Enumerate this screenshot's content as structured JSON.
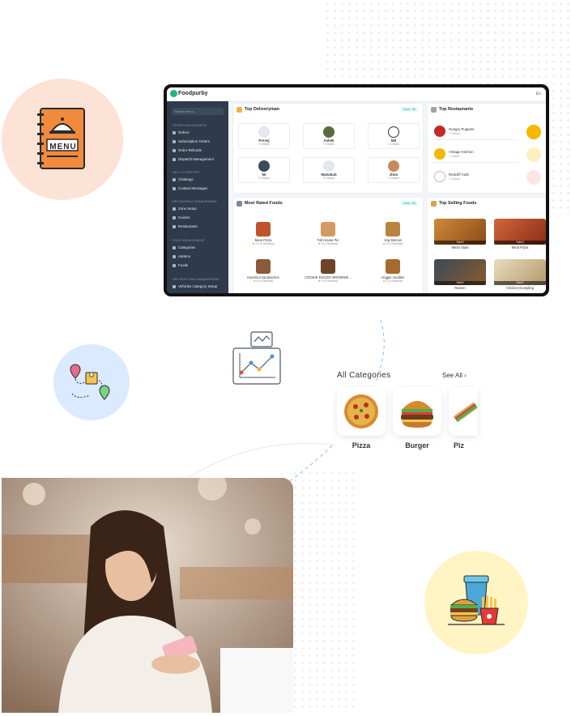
{
  "dashboard": {
    "brand": "Foodpurby",
    "language": "En",
    "search_placeholder": "Search menu...",
    "sidebar": {
      "sections": [
        {
          "title": "ORDER MANAGEMENT",
          "items": [
            "Orders",
            "Subscription Orders",
            "Order Refunds",
            "Dispatch Management"
          ]
        },
        {
          "title": "HELP & SUPPORT",
          "items": [
            "Chattings",
            "Contact Messages"
          ]
        },
        {
          "title": "RESTAURANT MANAGEMENT",
          "items": [
            "Zone Setup",
            "Cuisine",
            "Restaurants"
          ]
        },
        {
          "title": "FOOD MANAGEMENT",
          "items": [
            "Categories",
            "Addons",
            "Foods"
          ]
        },
        {
          "title": "DELIVERY MAN MANAGEMENT",
          "items": [
            "Vehicles Category Setup"
          ]
        }
      ]
    },
    "top_deliveryman": {
      "title": "Top Deliveryman",
      "zone": "Zone : All",
      "items": [
        {
          "name": "Pervej",
          "orders": "0 Orders"
        },
        {
          "name": "Ashek",
          "orders": "2 Orders"
        },
        {
          "name": "Md",
          "orders": "1 Orders"
        },
        {
          "name": "Mr",
          "orders": "0 Orders"
        },
        {
          "name": "Mahabub",
          "orders": "0 Orders"
        },
        {
          "name": "Jhon",
          "orders": "1 Orders"
        }
      ]
    },
    "top_restaurants": {
      "title": "Top Restaurants",
      "items": [
        {
          "name": "Hungry Puppets",
          "orders": "2 Orders",
          "color": "#c62828"
        },
        {
          "name": "Vintage Kitchen",
          "orders": "1 Orders",
          "color": "#f5b700"
        },
        {
          "name": "Redcliff Cafe",
          "orders": "1 Orders",
          "color": "#ffffff"
        }
      ]
    },
    "most_rated_foods": {
      "title": "Most Rated Foods",
      "zone": "Zone : All",
      "items": [
        {
          "name": "Meat Pizza",
          "rating": "4.3",
          "reviews": "(3 Reviews)",
          "color": "#c0532b"
        },
        {
          "name": "Tull House Pie",
          "rating": "5",
          "reviews": "(1 Reviews)",
          "color": "#d59a63"
        },
        {
          "name": "Veg Momos",
          "rating": "5",
          "reviews": "(1 Reviews)",
          "color": "#b9843c"
        },
        {
          "name": "Hazelnut sandwiches",
          "rating": "5",
          "reviews": "(1 Reviews)",
          "color": "#8a5a3a"
        },
        {
          "name": "COOKIE DOUGH BROWNIE...",
          "rating": "5",
          "reviews": "(1 Reviews)",
          "color": "#6d4428"
        },
        {
          "name": "Veggie noodles",
          "rating": "5",
          "reviews": "(1 Reviews)",
          "color": "#a66a2e"
        }
      ]
    },
    "top_selling_foods": {
      "title": "Top Selling Foods",
      "items": [
        {
          "name": "Medu Vada",
          "sold": "Sold:3",
          "color": "#b46a2a"
        },
        {
          "name": "Meat Pizza",
          "sold": "Sold:3",
          "color": "#b0472b"
        },
        {
          "name": "Ramen",
          "sold": "Sold:2",
          "color": "#6b4a2c"
        },
        {
          "name": "Chicken Dumpling",
          "sold": "Sold:2",
          "color": "#c9b48c"
        }
      ]
    }
  },
  "categories": {
    "title": "All Categories",
    "see_all": "See All",
    "items": [
      {
        "label": "Pizza"
      },
      {
        "label": "Burger"
      },
      {
        "label": "Piz"
      }
    ]
  },
  "icons": {
    "menu_book": "menu-book-icon",
    "delivery_route": "delivery-route-icon",
    "analytics": "analytics-chart-icon",
    "fast_food": "fast-food-icon"
  },
  "menu_book_text": "MENU",
  "colors": {
    "peach_circle": "#fde3d6",
    "blue_circle": "#dbeafe",
    "yellow_circle": "#fff4c4",
    "sidebar": "#2f3b4c",
    "accent_green": "#23b57a"
  }
}
